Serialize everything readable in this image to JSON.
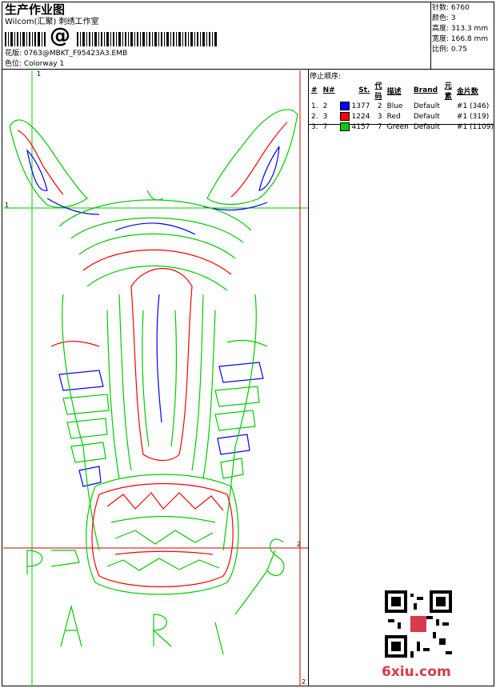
{
  "header": {
    "title": "生产作业图",
    "company": "Wilcom(汇聚) 刺绣工作室",
    "barcode_text": "@",
    "design_label": "花版:",
    "design_value": "0763@MBKT_F95423A3.EMB",
    "colorway_label": "色位:",
    "colorway_value": "Colorway 1"
  },
  "stats": {
    "stitches_label": "针数:",
    "stitches": "6760",
    "colors_label": "颜色:",
    "colors": "3",
    "height_label": "高度:",
    "height": "313.3 mm",
    "width_label": "宽度:",
    "width": "166.8 mm",
    "scale_label": "比例:",
    "scale": "0.75"
  },
  "stop_sequence": {
    "title": "停止顺序:",
    "columns": [
      "#",
      "N#",
      "St.",
      "代码",
      "描述",
      "Brand",
      "元素",
      "金片数"
    ],
    "rows": [
      {
        "idx": "1.",
        "n": "2",
        "color": "#0000ff",
        "st": "1377",
        "code": "2",
        "desc": "Blue",
        "brand": "Default",
        "elem": "#1 (346)"
      },
      {
        "idx": "2.",
        "n": "3",
        "color": "#ff0000",
        "st": "1224",
        "code": "3",
        "desc": "Red",
        "brand": "Default",
        "elem": "#1 (319)"
      },
      {
        "idx": "3.",
        "n": "7",
        "color": "#00cc00",
        "st": "4157",
        "code": "7",
        "desc": "Green",
        "brand": "Default",
        "elem": "#1 (1109)"
      }
    ]
  },
  "markers": {
    "m1": "1",
    "m2": "2"
  },
  "watermark": "6xiu.com",
  "palette": {
    "blue": "#0000ff",
    "red": "#ff0000",
    "green": "#00cc00",
    "guide": "#00cc00"
  }
}
